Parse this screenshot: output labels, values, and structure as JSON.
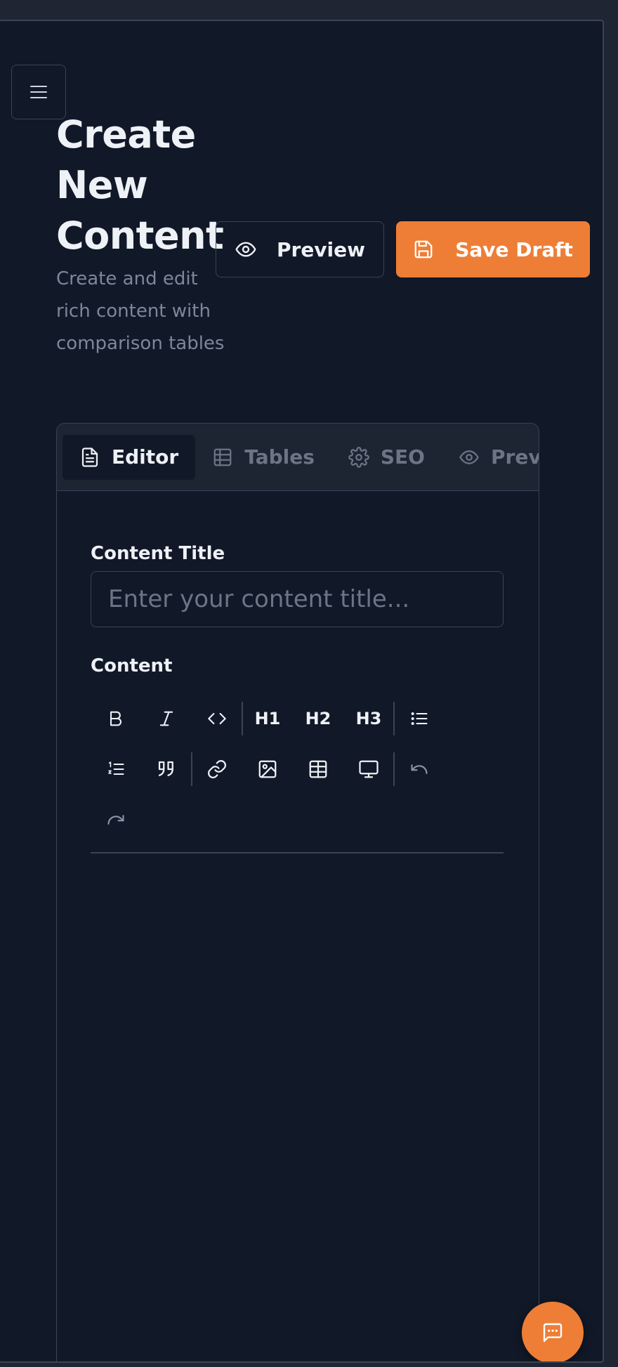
{
  "header": {
    "title": "Create New Content",
    "subtitle": "Create and edit rich content with comparison tables",
    "preview_label": "Preview",
    "save_label": "Save Draft"
  },
  "tabs": [
    {
      "label": "Editor",
      "icon": "file-text-icon",
      "active": true
    },
    {
      "label": "Tables",
      "icon": "table-icon",
      "active": false
    },
    {
      "label": "SEO",
      "icon": "gear-icon",
      "active": false
    },
    {
      "label": "Preview",
      "icon": "eye-icon",
      "active": false
    }
  ],
  "form": {
    "title_label": "Content Title",
    "title_placeholder": "Enter your content title...",
    "title_value": "",
    "content_label": "Content"
  },
  "toolbar": {
    "h1": "H1",
    "h2": "H2",
    "h3": "H3"
  },
  "colors": {
    "accent": "#ee7e36",
    "background": "#111827",
    "border": "#3b4455"
  }
}
